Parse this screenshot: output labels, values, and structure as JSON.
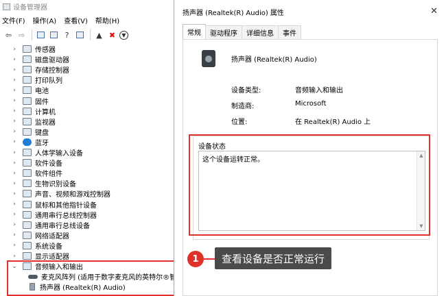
{
  "device_manager": {
    "title": "设备管理器",
    "menu": [
      "文件(F)",
      "操作(A)",
      "查看(V)",
      "帮助(H)"
    ],
    "toolbar_icons": [
      "back-arrow-icon",
      "forward-arrow-icon",
      "properties-icon",
      "scan-icon",
      "update-driver-icon",
      "monitor-icon",
      "enable-device-icon",
      "uninstall-x-icon",
      "download-icon"
    ],
    "tree": [
      {
        "label": "传感器",
        "expanded": false
      },
      {
        "label": "磁盘驱动器",
        "expanded": false
      },
      {
        "label": "存储控制器",
        "expanded": false
      },
      {
        "label": "打印队列",
        "expanded": false
      },
      {
        "label": "电池",
        "expanded": false
      },
      {
        "label": "固件",
        "expanded": false
      },
      {
        "label": "计算机",
        "expanded": false
      },
      {
        "label": "监视器",
        "expanded": false
      },
      {
        "label": "键盘",
        "expanded": false
      },
      {
        "label": "蓝牙",
        "expanded": false
      },
      {
        "label": "人体学输入设备",
        "expanded": false
      },
      {
        "label": "软件设备",
        "expanded": false
      },
      {
        "label": "软件组件",
        "expanded": false
      },
      {
        "label": "生物识别设备",
        "expanded": false
      },
      {
        "label": "声音、视频和游戏控制器",
        "expanded": false
      },
      {
        "label": "鼠标和其他指针设备",
        "expanded": false
      },
      {
        "label": "通用串行总线控制器",
        "expanded": false
      },
      {
        "label": "通用串行总线设备",
        "expanded": false
      },
      {
        "label": "网络适配器",
        "expanded": false
      },
      {
        "label": "系统设备",
        "expanded": false
      },
      {
        "label": "显示适配器",
        "expanded": false
      },
      {
        "label": "音频输入和输出",
        "expanded": true
      },
      {
        "label": "麦克风阵列 (适用于数字麦克风的英特尔®智",
        "child": true
      },
      {
        "label": "扬声器 (Realtek(R) Audio)",
        "child": true
      }
    ]
  },
  "dialog": {
    "title": "扬声器 (Realtek(R) Audio) 属性",
    "close": "✕",
    "tabs": [
      "常规",
      "驱动程序",
      "详细信息",
      "事件"
    ],
    "device_name": "扬声器 (Realtek(R) Audio)",
    "properties": [
      {
        "label": "设备类型:",
        "value": "音频输入和输出"
      },
      {
        "label": "制造商:",
        "value": "Microsoft"
      },
      {
        "label": "位置:",
        "value": "在 Realtek(R) Audio 上"
      }
    ],
    "status_legend": "设备状态",
    "status_text": "这个设备运转正常。"
  },
  "annotation": {
    "number": "1",
    "text": "查看设备是否正常运行"
  },
  "colors": {
    "highlight": "#e0302a",
    "callout_bg": "#4a4a4a"
  }
}
